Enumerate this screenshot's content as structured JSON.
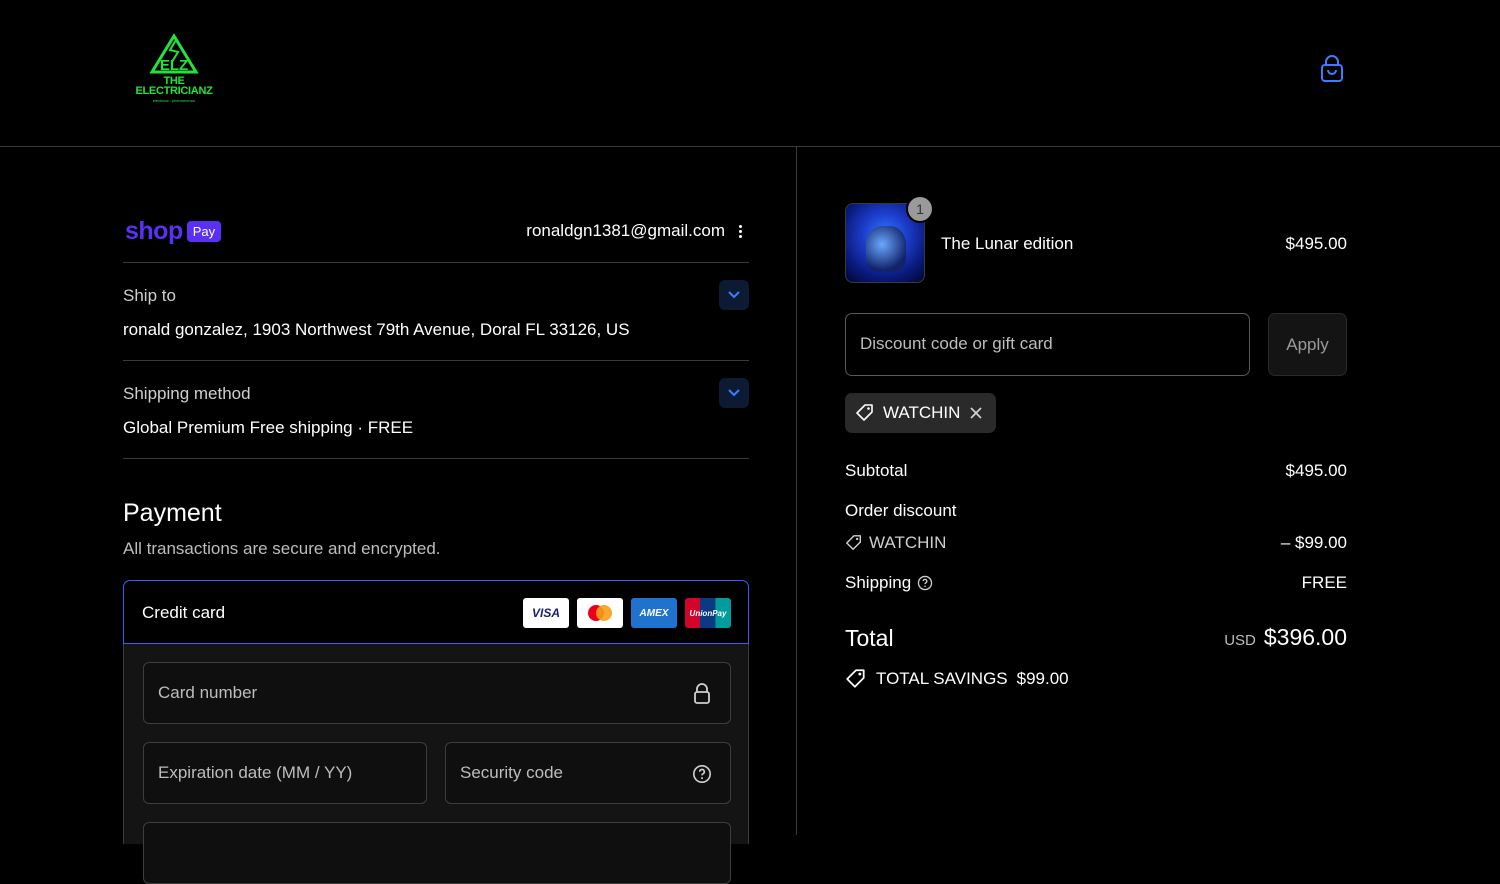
{
  "header": {
    "logo_top": "ELZ",
    "logo_name_line1": "THE",
    "logo_name_line2": "ELECTRICIANZ",
    "logo_tagline": "electrical . phenomenon"
  },
  "colors": {
    "accent": "#3d5afe",
    "shop_pay": "#5a31f4",
    "logo_green": "#22e33a"
  },
  "express": {
    "shop_label": "shop",
    "pay_label": "Pay",
    "email": "ronaldgn1381@gmail.com"
  },
  "ship_to": {
    "label": "Ship to",
    "value": "ronald gonzalez, 1903 Northwest 79th Avenue, Doral FL 33126, US"
  },
  "shipping_method": {
    "label": "Shipping method",
    "value": "Global Premium Free shipping · FREE"
  },
  "payment": {
    "title": "Payment",
    "subtitle": "All transactions are secure and encrypted.",
    "method_label": "Credit card",
    "card_brands": [
      "VISA",
      "Mastercard",
      "AMEX",
      "UnionPay"
    ],
    "card_number_placeholder": "Card number",
    "expiration_placeholder": "Expiration date (MM / YY)",
    "security_code_placeholder": "Security code"
  },
  "order": {
    "item_name": "The Lunar edition",
    "item_price": "$495.00",
    "item_quantity": "1",
    "discount_placeholder": "Discount code or gift card",
    "apply_label": "Apply",
    "applied_code": "WATCHIN",
    "subtotal_label": "Subtotal",
    "subtotal_value": "$495.00",
    "order_discount_label": "Order discount",
    "discount_code_label": "WATCHIN",
    "discount_value": "– $99.00",
    "shipping_label": "Shipping",
    "shipping_value": "FREE",
    "total_label": "Total",
    "currency": "USD",
    "total_value": "$396.00",
    "savings_label": "TOTAL SAVINGS",
    "savings_value": "$99.00"
  }
}
